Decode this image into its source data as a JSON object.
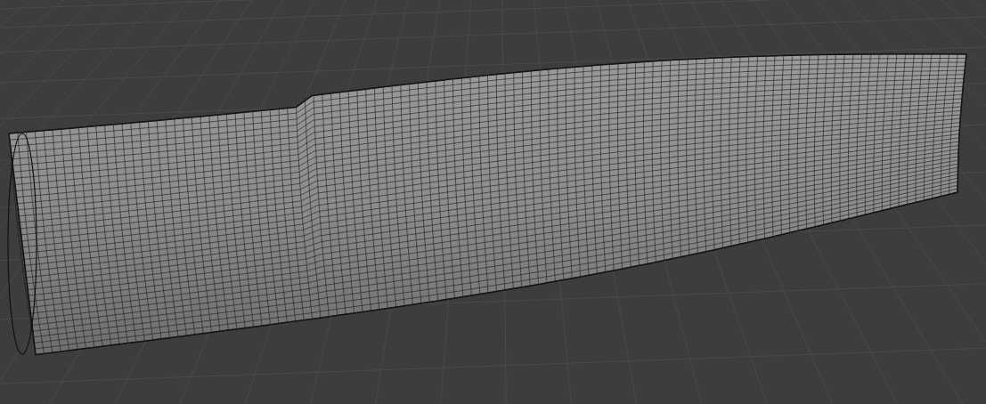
{
  "viewport": {
    "grid": true,
    "wireframe": true
  }
}
